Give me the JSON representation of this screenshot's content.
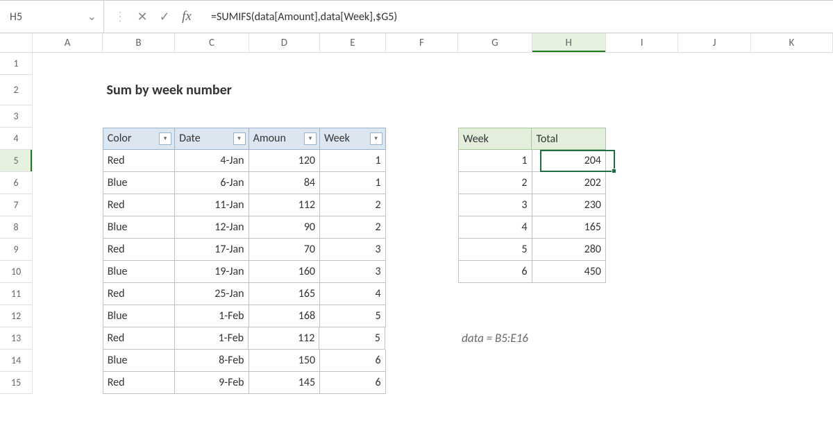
{
  "name_box": "H5",
  "formula": "=SUMIFS(data[Amount],data[Week],$G5)",
  "title": "Sum by week number",
  "columns": [
    "A",
    "B",
    "C",
    "D",
    "E",
    "F",
    "G",
    "H",
    "I",
    "J",
    "K"
  ],
  "active_col": "H",
  "active_row": "5",
  "row_labels": [
    "1",
    "2",
    "3",
    "4",
    "5",
    "6",
    "7",
    "8",
    "9",
    "10",
    "11",
    "12",
    "13",
    "14",
    "15"
  ],
  "table1": {
    "headers": {
      "color": "Color",
      "date": "Date",
      "amount": "Amoun",
      "week": "Week"
    },
    "rows": [
      {
        "color": "Red",
        "date": "4-Jan",
        "amount": "120",
        "week": "1"
      },
      {
        "color": "Blue",
        "date": "6-Jan",
        "amount": "84",
        "week": "1"
      },
      {
        "color": "Red",
        "date": "11-Jan",
        "amount": "112",
        "week": "2"
      },
      {
        "color": "Blue",
        "date": "12-Jan",
        "amount": "90",
        "week": "2"
      },
      {
        "color": "Red",
        "date": "17-Jan",
        "amount": "70",
        "week": "3"
      },
      {
        "color": "Blue",
        "date": "19-Jan",
        "amount": "160",
        "week": "3"
      },
      {
        "color": "Red",
        "date": "25-Jan",
        "amount": "165",
        "week": "4"
      },
      {
        "color": "Blue",
        "date": "1-Feb",
        "amount": "168",
        "week": "5"
      },
      {
        "color": "Red",
        "date": "1-Feb",
        "amount": "112",
        "week": "5"
      },
      {
        "color": "Blue",
        "date": "8-Feb",
        "amount": "150",
        "week": "6"
      },
      {
        "color": "Red",
        "date": "9-Feb",
        "amount": "145",
        "week": "6"
      }
    ]
  },
  "table2": {
    "headers": {
      "week": "Week",
      "total": "Total"
    },
    "rows": [
      {
        "week": "1",
        "total": "204"
      },
      {
        "week": "2",
        "total": "202"
      },
      {
        "week": "3",
        "total": "230"
      },
      {
        "week": "4",
        "total": "165"
      },
      {
        "week": "5",
        "total": "280"
      },
      {
        "week": "6",
        "total": "450"
      }
    ]
  },
  "note": "data = B5:E16"
}
